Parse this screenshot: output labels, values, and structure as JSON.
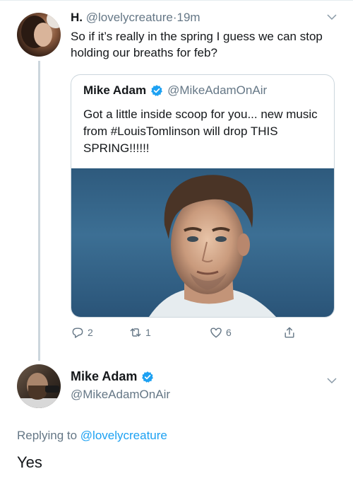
{
  "tweet": {
    "author_name": "H.",
    "author_handle": "@lovelycreature",
    "separator": "·",
    "time": "19m",
    "text": "So if it’s really in the spring I guess we can stop holding our breaths for feb?",
    "quote": {
      "author_name": "Mike Adam",
      "author_handle": "@MikeAdamOnAir",
      "text": "Got a little inside scoop for you... new music from #LouisTomlinson will drop THIS SPRING!!!!!!"
    },
    "actions": {
      "reply_count": "2",
      "retweet_count": "1",
      "like_count": "6"
    }
  },
  "reply": {
    "author_name": "Mike Adam",
    "author_handle": "@MikeAdamOnAir",
    "replying_prefix": "Replying to",
    "replying_to": "@lovelycreature",
    "text": "Yes"
  },
  "colors": {
    "accent": "#1da1f2",
    "secondary_text": "#657786",
    "border": "#ccd6dd"
  },
  "icons": [
    "chevron-down-icon",
    "verified-badge-icon",
    "reply-icon",
    "retweet-icon",
    "like-icon",
    "share-icon"
  ]
}
